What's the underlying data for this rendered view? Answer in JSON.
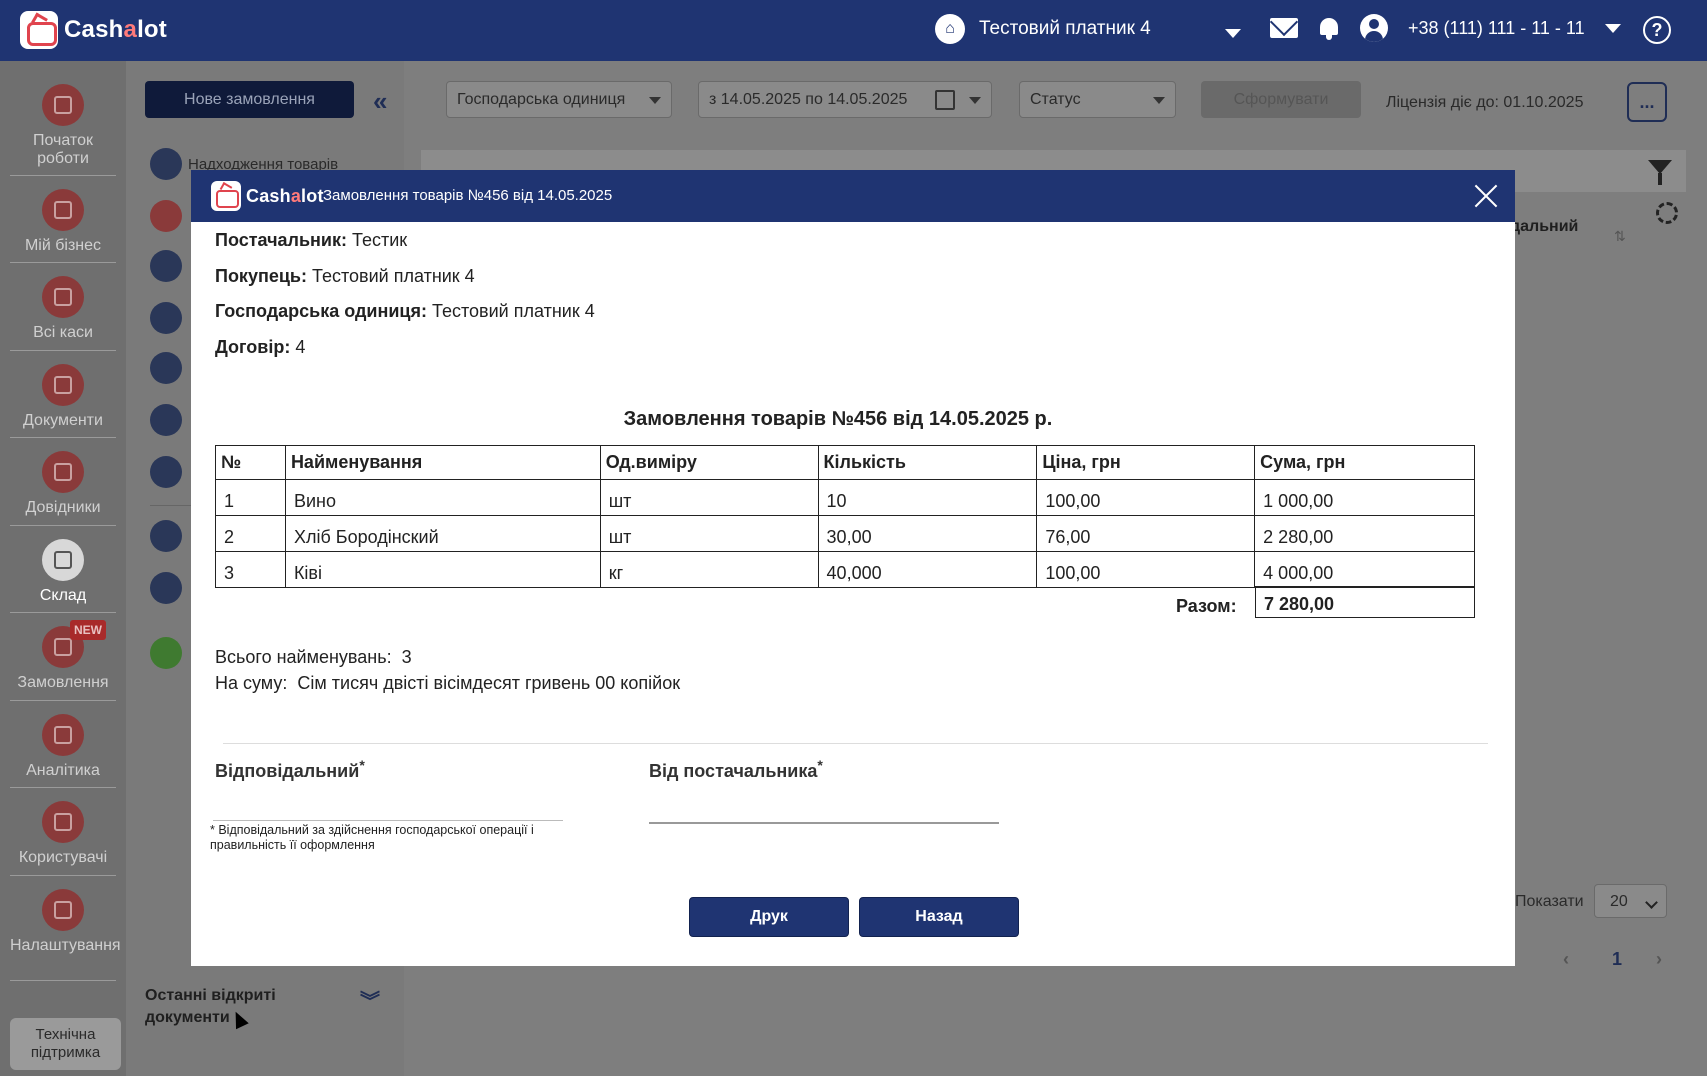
{
  "header": {
    "logo_text_1": "Cash",
    "logo_text_2": "a",
    "logo_text_3": "lot",
    "company": "Тестовий платник 4",
    "phone": "+38 (111) 111 - 11 - 11",
    "help": "?"
  },
  "leftnav": {
    "items": [
      {
        "label": "Початок роботи",
        "icon": "start-icon"
      },
      {
        "label": "Мій бізнес",
        "icon": "home-icon"
      },
      {
        "label": "Всі каси",
        "icon": "cash-register-icon"
      },
      {
        "label": "Документи",
        "icon": "documents-icon"
      },
      {
        "label": "Довідники",
        "icon": "reference-icon"
      },
      {
        "label": "Склад",
        "icon": "warehouse-icon"
      },
      {
        "label": "Замовлення",
        "icon": "orders-icon"
      },
      {
        "label": "Аналітика",
        "icon": "analytics-icon"
      },
      {
        "label": "Користувачі",
        "icon": "users-icon"
      },
      {
        "label": "Налаштування",
        "icon": "settings-icon"
      }
    ],
    "new_badge": "NEW",
    "support": "Технічна підтримка"
  },
  "subnav": {
    "new_order": "Нове замовлення",
    "first_item": "Надходження товарів",
    "recent": "Останні відкриті документи"
  },
  "filters": {
    "unit": "Господарська одиниця",
    "dates": "з 14.05.2025 по 14.05.2025",
    "status": "Статус",
    "form_button": "Сформувати",
    "license": "Ліцензія діє до: 01.10.2025",
    "more": "..."
  },
  "list": {
    "column_partial": "дальний",
    "show_label": "Показати",
    "page_size": "20",
    "page": "1"
  },
  "modal": {
    "logo_text_1": "Cash",
    "logo_text_2": "a",
    "logo_text_3": "lot",
    "title": "Замовлення товарів №456 від 14.05.2025",
    "supplier_label": "Постачальник:",
    "supplier": "Тестик",
    "buyer_label": "Покупець:",
    "buyer": "Тестовий платник 4",
    "unit_label": "Господарська одиниця:",
    "unit": "Тестовий платник 4",
    "contract_label": "Договір:",
    "contract": "4",
    "doc_title": "Замовлення товарів №456 від 14.05.2025 р.",
    "columns": [
      "№",
      "Найменування",
      "Од.виміру",
      "Кількість",
      "Ціна, грн",
      "Сума, грн"
    ],
    "rows": [
      [
        "1",
        "Вино",
        "шт",
        "10",
        "100,00",
        "1 000,00"
      ],
      [
        "2",
        "Хліб Бородінский",
        "шт",
        "30,00",
        "76,00",
        "2 280,00"
      ],
      [
        "3",
        "Ківі",
        "кг",
        "40,000",
        "100,00",
        "4 000,00"
      ]
    ],
    "total_label": "Разом:",
    "total": "7 280,00",
    "count_label": "Всього найменувань:",
    "count": "3",
    "sum_label": "На суму:",
    "sum_words": "Сім тисяч двісті вісімдесят гривень 00 копійок",
    "responsible": "Відповідальний",
    "from_supplier": "Від постачальника",
    "asterisk": "*",
    "footnote": "* Відповідальний за здійснення господарської операції і правильність її оформлення",
    "print_button": "Друк",
    "back_button": "Назад"
  }
}
